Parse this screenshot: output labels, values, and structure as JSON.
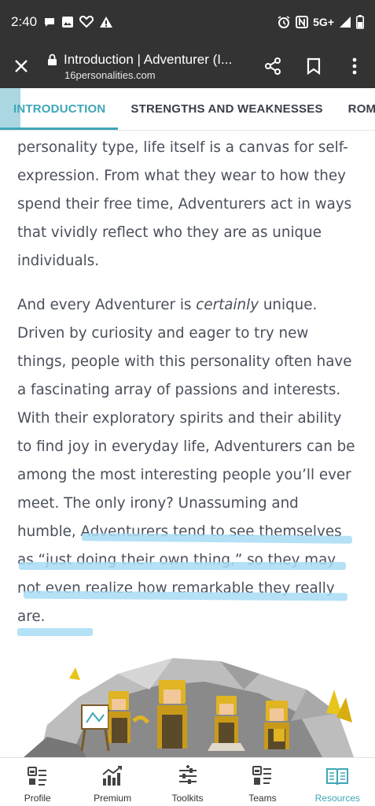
{
  "status_bar": {
    "time": "2:40",
    "network": "5G+",
    "left_icons": [
      "chat-bubble-icon",
      "image-icon",
      "heart-icon",
      "warning-icon"
    ],
    "right_icons": [
      "alarm-icon",
      "nfc-icon",
      "signal-icon",
      "battery-icon"
    ]
  },
  "browser": {
    "title": "Introduction | Adventurer (I...",
    "domain": "16personalities.com",
    "icons": [
      "close-icon",
      "lock-icon",
      "share-icon",
      "bookmark-icon",
      "more-vert-icon"
    ]
  },
  "tabs": [
    {
      "label": "INTRODUCTION",
      "active": true
    },
    {
      "label": "STRENGTHS AND WEAKNESSES",
      "active": false
    },
    {
      "label": "ROMANTIC RELATIONSHIPS",
      "active": false
    }
  ],
  "article": {
    "p1": "personality type, life itself is a canvas for self-expression. From what they wear to how they spend their free time, Adventurers act in ways that vividly reflect who they are as unique individuals.",
    "p2_before": "And every Adventurer is ",
    "p2_emph": "certainly",
    "p2_after": " unique. Driven by curiosity and eager to try new things, people with this personality often have a fascinating array of passions and interests. With their exploratory spirits and their ability to find joy in everyday life, Adventurers can be among the most interesting people you’ll ever meet. The only irony? Unassuming and humble, Adventurers tend to see themselves as “just doing their own thing,” so they may not even realize how remarkable they really are."
  },
  "colors": {
    "accent": "#3ea6b8",
    "bar": "#333333",
    "text": "#4a4f5b",
    "highlight": "#a8dcf4"
  },
  "bottom_nav": [
    {
      "label": "Profile",
      "icon": "profile-icon",
      "active": false
    },
    {
      "label": "Premium",
      "icon": "premium-chart-icon",
      "active": false
    },
    {
      "label": "Toolkits",
      "icon": "toolkits-sliders-icon",
      "active": false
    },
    {
      "label": "Teams",
      "icon": "teams-icon",
      "active": false
    },
    {
      "label": "Resources",
      "icon": "resources-book-icon",
      "active": true
    }
  ]
}
